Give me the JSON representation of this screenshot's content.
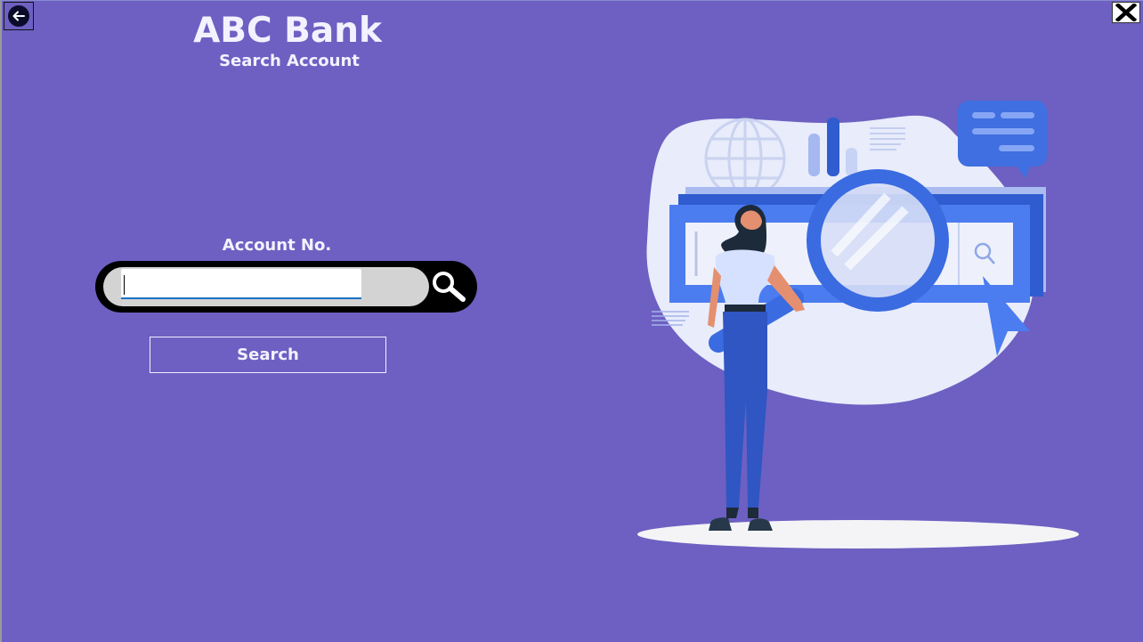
{
  "header": {
    "title": "ABC Bank",
    "subtitle": "Search Account"
  },
  "form": {
    "field_label": "Account No.",
    "account_value": "",
    "search_button_label": "Search"
  },
  "icons": {
    "back": "arrow-left-circle-icon",
    "close": "close-x-icon",
    "search": "magnifier-icon"
  },
  "colors": {
    "background": "#6d60c2",
    "accent_blue": "#3f6fe0",
    "illustration_blob": "#e8ecfb"
  }
}
